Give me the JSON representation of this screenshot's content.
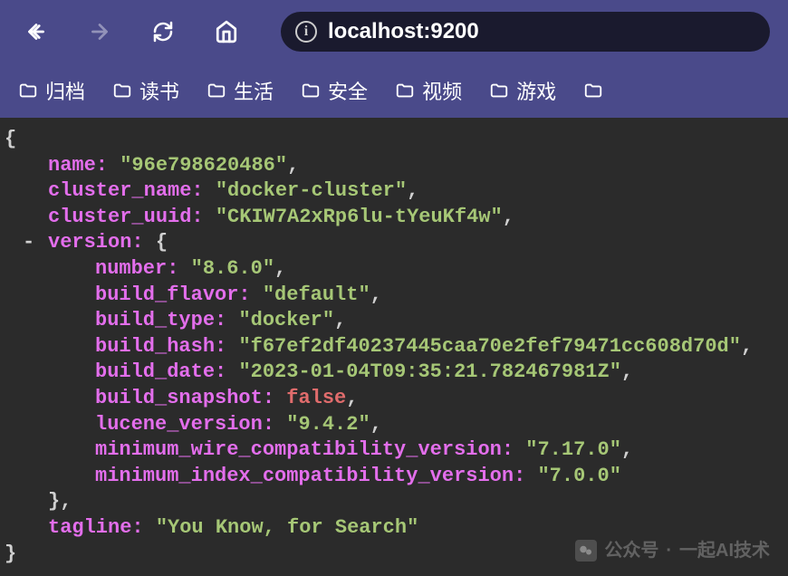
{
  "toolbar": {
    "url": "localhost:9200"
  },
  "bookmarks": [
    {
      "label": "归档"
    },
    {
      "label": "读书"
    },
    {
      "label": "生活"
    },
    {
      "label": "安全"
    },
    {
      "label": "视频"
    },
    {
      "label": "游戏"
    }
  ],
  "json": {
    "name": "\"96e798620486\"",
    "cluster_name": "\"docker-cluster\"",
    "cluster_uuid": "\"CKIW7A2xRp6lu-tYeuKf4w\"",
    "version": {
      "number": "\"8.6.0\"",
      "build_flavor": "\"default\"",
      "build_type": "\"docker\"",
      "build_hash": "\"f67ef2df40237445caa70e2fef79471cc608d70d\"",
      "build_date": "\"2023-01-04T09:35:21.782467981Z\"",
      "build_snapshot": "false",
      "lucene_version": "\"9.4.2\"",
      "minimum_wire_compatibility_version": "\"7.17.0\"",
      "minimum_index_compatibility_version": "\"7.0.0\""
    },
    "tagline": "\"You Know, for Search\""
  },
  "keys": {
    "name": "name:",
    "cluster_name": "cluster_name:",
    "cluster_uuid": "cluster_uuid:",
    "version": "version:",
    "number": "number:",
    "build_flavor": "build_flavor:",
    "build_type": "build_type:",
    "build_hash": "build_hash:",
    "build_date": "build_date:",
    "build_snapshot": "build_snapshot:",
    "lucene_version": "lucene_version:",
    "minimum_wire_compatibility_version": "minimum_wire_compatibility_version:",
    "minimum_index_compatibility_version": "minimum_index_compatibility_version:",
    "tagline": "tagline:"
  },
  "watermark": {
    "label1": "公众号",
    "label2": "一起AI技术"
  }
}
